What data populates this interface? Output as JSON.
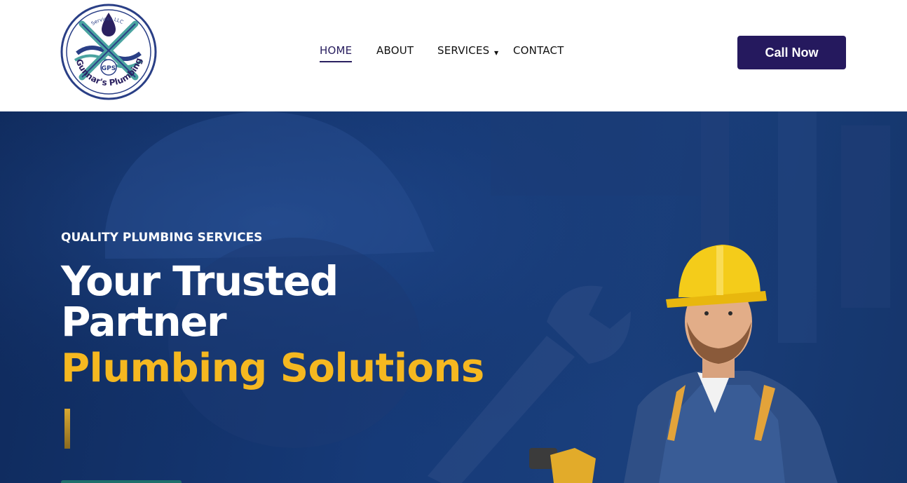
{
  "header": {
    "logo": {
      "alt": "Gunnar's Plumbing Services LLC logo",
      "ring_text": "Gunnar's Plumbing",
      "top_text": "Services LLC",
      "badge": "GPS"
    },
    "nav": [
      {
        "label": "HOME",
        "active": true
      },
      {
        "label": "ABOUT",
        "active": false
      },
      {
        "label": "SERVICES",
        "active": false,
        "has_dropdown": true
      },
      {
        "label": "CONTACT",
        "active": false
      }
    ],
    "cta_label": "Call Now"
  },
  "hero": {
    "eyebrow": "QUALITY PLUMBING SERVICES",
    "title_line_1": "Your Trusted",
    "title_line_2": "Partner",
    "title_accent": "Plumbing Solutions"
  },
  "colors": {
    "brand_navy": "#25195e",
    "accent_yellow": "#f5b820",
    "hero_blue": "#163a78",
    "nav_text": "#111111"
  },
  "icons": {
    "dropdown": "caret-down-icon",
    "logo": "wrench-cross-logo"
  }
}
